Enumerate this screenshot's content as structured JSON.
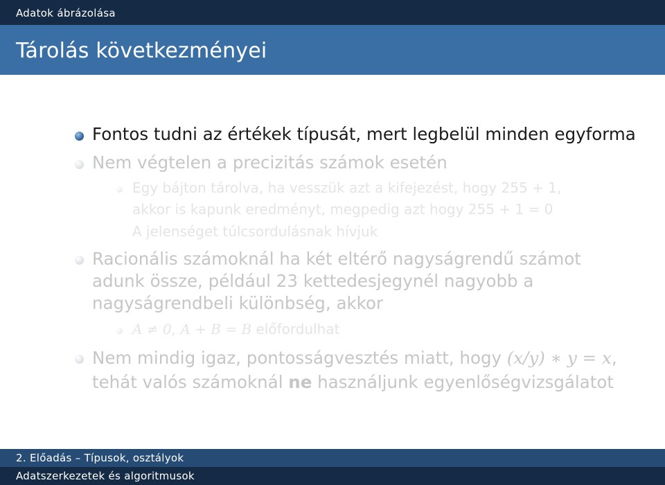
{
  "header": {
    "section": "Adatok ábrázolása"
  },
  "slide": {
    "title": "Tárolás következményei"
  },
  "bullets": {
    "b1": "Fontos tudni az értékek típusát, mert legbelül minden egyforma",
    "b2": "Nem végtelen a precizitás számok esetén",
    "b2_sub_line1": "Egy bájton tárolva, ha vesszük azt a kifejezést, hogy 255 + 1,",
    "b2_sub_line2": "akkor is kapunk eredményt, megpedig azt hogy 255 + 1 = 0",
    "b2_sub2": "A jelenséget túlcsordulásnak hívjuk",
    "b3_line1": "Racionális számoknál ha két eltérő nagyságrendű számot",
    "b3_line2": "adunk össze, például 23 kettedesjegynél nagyobb a",
    "b3_line3": "nagyságrendbeli különbség, akkor",
    "b3_sub_math": "A ≠ 0, A + B = B",
    "b3_sub_text": " előfordulhat",
    "b4_line1_text": "Nem mindig igaz, pontosságvesztés miatt, hogy ",
    "b4_line1_math": "(x/y) ∗ y = x",
    "b4_line1_end": ",",
    "b4_line2_pre": "tehát valós számoknál ",
    "b4_line2_bold": "ne",
    "b4_line2_post": " használjunk egyenlőségvizsgálatot"
  },
  "footer": {
    "line1": "2. Előadás – Típusok, osztályok",
    "line2": "Adatszerkezetek és algoritmusok"
  }
}
